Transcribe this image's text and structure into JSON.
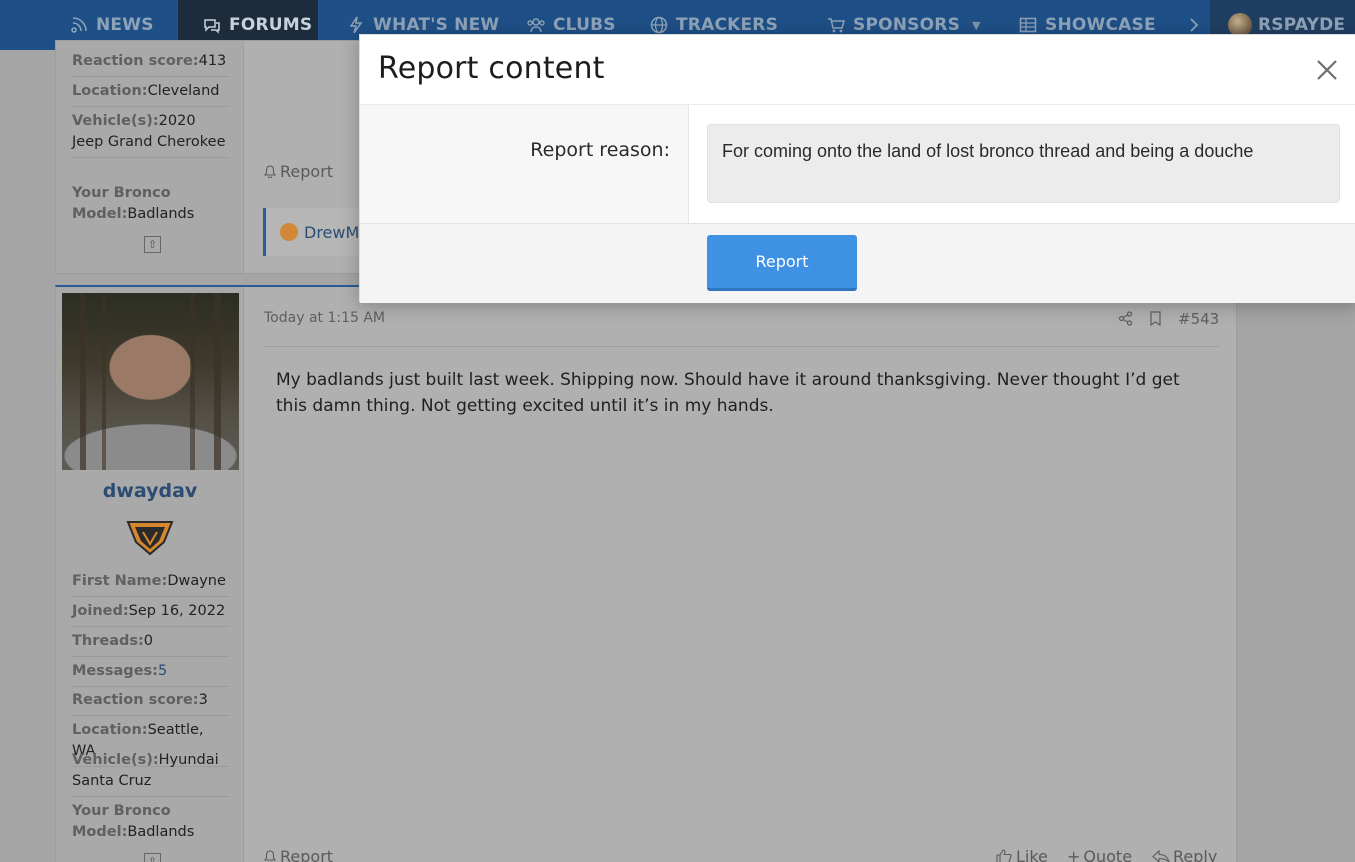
{
  "nav": {
    "items": [
      {
        "label": "NEWS",
        "icon": "news-icon"
      },
      {
        "label": "FORUMS",
        "icon": "forums-icon"
      },
      {
        "label": "WHAT'S NEW",
        "icon": "bolt-icon"
      },
      {
        "label": "CLUBS",
        "icon": "clubs-icon"
      },
      {
        "label": "TRACKERS",
        "icon": "globe-icon"
      },
      {
        "label": "SPONSORS",
        "icon": "cart-icon"
      },
      {
        "label": "SHOWCASE",
        "icon": "grid-icon"
      }
    ],
    "user": "RSPAYDE",
    "colors": {
      "nav_bg": "#1e4f86",
      "active_bg": "#1c2c3d"
    }
  },
  "prev_post": {
    "fields": [
      {
        "key": "Reaction score:",
        "value": "413"
      },
      {
        "key": "Location:",
        "value": "Cleveland"
      },
      {
        "key": "Vehicle(s):",
        "value": "2020 Jeep Grand Cherokee"
      },
      {
        "key": "Your Bronco Model:",
        "value": "Badlands"
      }
    ],
    "report_label": "Report",
    "mention": "DrewMo"
  },
  "post": {
    "username": "dwaydav",
    "timestamp": "Today at 1:15 AM",
    "post_number": "#543",
    "body": "My badlands just built last week. Shipping now. Should have it around thanksgiving. Never thought I’d get this damn thing. Not getting excited until it’s in my hands.",
    "fields": [
      {
        "key": "First Name:",
        "value": "Dwayne"
      },
      {
        "key": "Joined:",
        "value": "Sep 16, 2022"
      },
      {
        "key": "Threads:",
        "value": "0"
      },
      {
        "key": "Messages:",
        "value": "5"
      },
      {
        "key": "Reaction score:",
        "value": "3"
      },
      {
        "key": "Location:",
        "value": "Seattle, WA"
      },
      {
        "key": "Vehicle(s):",
        "value": "Hyundai Santa Cruz"
      },
      {
        "key": "Your Bronco Model:",
        "value": "Badlands"
      }
    ],
    "report_label": "Report",
    "like_label": "Like",
    "quote_label": "Quote",
    "reply_label": "Reply"
  },
  "modal": {
    "title": "Report content",
    "reason_label": "Report reason:",
    "reason_value": "For coming onto the land of lost bronco thread and being a douche",
    "submit_label": "Report",
    "accent": "#3f91e4"
  }
}
